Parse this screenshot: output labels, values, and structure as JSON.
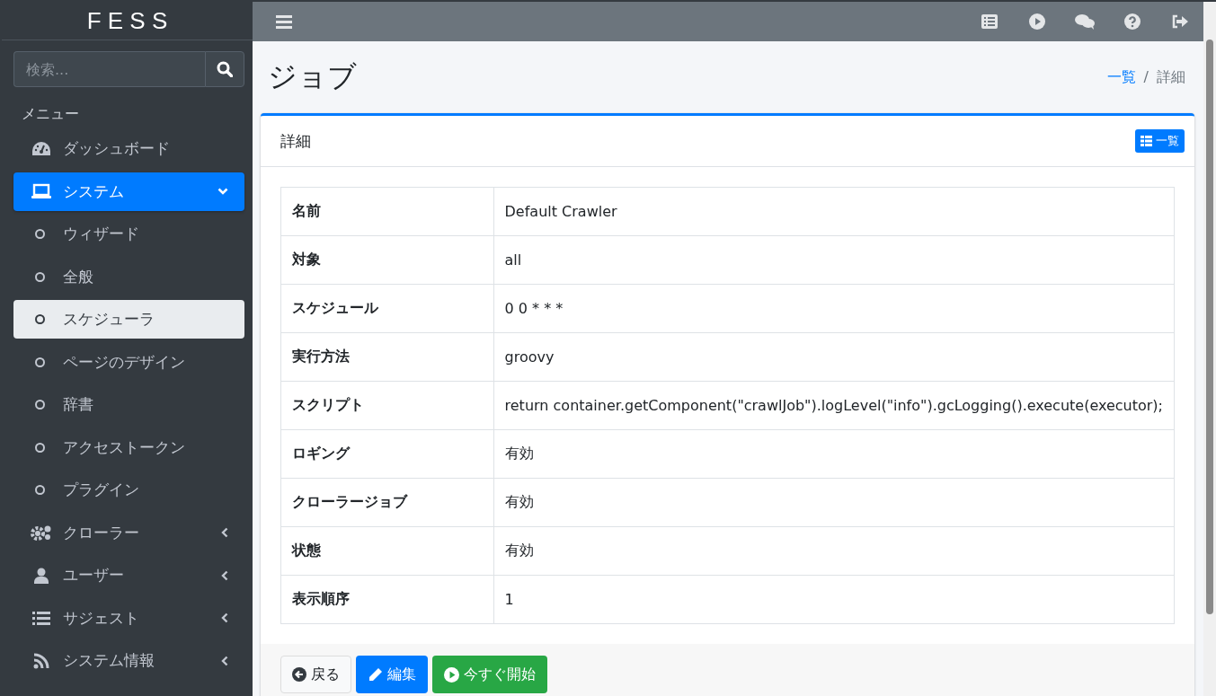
{
  "brand": "F E S S",
  "search": {
    "placeholder": "検索..."
  },
  "menu_header": "メニュー",
  "sidebar": {
    "items": [
      {
        "label": "ダッシュボード",
        "selected": false
      },
      {
        "label": "システム",
        "selected": true,
        "expanded": true,
        "children": [
          {
            "label": "ウィザード",
            "selected": false
          },
          {
            "label": "全般",
            "selected": false
          },
          {
            "label": "スケジューラ",
            "selected": true
          },
          {
            "label": "ページのデザイン",
            "selected": false
          },
          {
            "label": "辞書",
            "selected": false
          },
          {
            "label": "アクセストークン",
            "selected": false
          },
          {
            "label": "プラグイン",
            "selected": false
          }
        ]
      },
      {
        "label": "クローラー",
        "selected": false,
        "expanded": false
      },
      {
        "label": "ユーザー",
        "selected": false,
        "expanded": false
      },
      {
        "label": "サジェスト",
        "selected": false,
        "expanded": false
      },
      {
        "label": "システム情報",
        "selected": false,
        "expanded": false
      }
    ]
  },
  "page_title": "ジョブ",
  "breadcrumb": [
    {
      "label": "一覧",
      "kind": "link"
    },
    {
      "label": "/",
      "kind": "separator"
    },
    {
      "label": "詳細",
      "kind": "current"
    }
  ],
  "card": {
    "title": "詳細",
    "list_button": "一覧",
    "rows": [
      {
        "label": "名前",
        "value": "Default Crawler"
      },
      {
        "label": "対象",
        "value": "all"
      },
      {
        "label": "スケジュール",
        "value": "0 0 * * *"
      },
      {
        "label": "実行方法",
        "value": "groovy"
      },
      {
        "label": "スクリプト",
        "value": "return container.getComponent(\"crawlJob\").logLevel(\"info\").gcLogging().execute(executor);"
      },
      {
        "label": "ロギング",
        "value": "有効"
      },
      {
        "label": "クローラージョブ",
        "value": "有効"
      },
      {
        "label": "状態",
        "value": "有効"
      },
      {
        "label": "表示順序",
        "value": "1"
      }
    ],
    "buttons": [
      {
        "kind": "back",
        "label": "戻る"
      },
      {
        "kind": "edit",
        "label": "編集"
      },
      {
        "kind": "start",
        "label": "今すぐ開始"
      }
    ]
  }
}
